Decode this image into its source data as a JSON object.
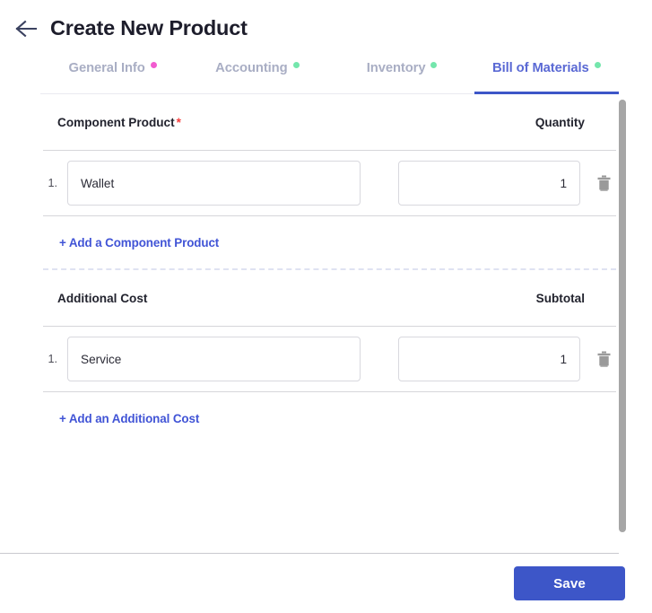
{
  "header": {
    "back_icon": "arrow-left-icon",
    "title": "Create New Product"
  },
  "tabs": [
    {
      "label": "General Info",
      "dot_color": "#f25bd0",
      "active": false
    },
    {
      "label": "Accounting",
      "dot_color": "#74e6ac",
      "active": false
    },
    {
      "label": "Inventory",
      "dot_color": "#74e6ac",
      "active": false
    },
    {
      "label": "Bill of Materials",
      "dot_color": "#74e6ac",
      "active": true
    }
  ],
  "sections": [
    {
      "col_main_header": "Component Product",
      "required_marker": "*",
      "col_right_header": "Quantity",
      "rows": [
        {
          "index": "1.",
          "name_value": "Wallet",
          "qty_value": "1",
          "delete_icon": "trash-icon"
        }
      ],
      "add_link": "+ Add a Component Product"
    },
    {
      "col_main_header": "Additional Cost",
      "required_marker": "",
      "col_right_header": "Subtotal",
      "rows": [
        {
          "index": "1.",
          "name_value": "Service",
          "qty_value": "1",
          "delete_icon": "trash-icon"
        }
      ],
      "add_link": "+ Add an Additional Cost"
    }
  ],
  "footer": {
    "save_label": "Save"
  },
  "colors": {
    "accent": "#3d56c8",
    "accent_text": "#4154d6",
    "tab_inactive": "#a9aec4",
    "required": "#f6403f",
    "scrollbar": "#a6a6a6"
  }
}
